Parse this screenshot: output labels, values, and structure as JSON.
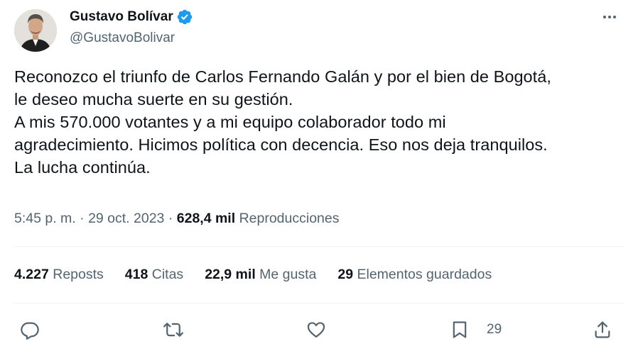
{
  "author": {
    "display_name": "Gustavo Bolívar",
    "handle": "@GustavoBolivar",
    "verified": true,
    "avatar_icon": "avatar-portrait"
  },
  "tweet": {
    "lines": [
      "Reconozco el triunfo de Carlos Fernando Galán y por el bien de Bogotá,",
      "le deseo mucha suerte en su gestión.",
      "A mis 570.000 votantes y a mi equipo colaborador todo mi",
      "agradecimiento. Hicimos política con decencia. Eso nos deja tranquilos.",
      "La lucha continúa."
    ]
  },
  "meta": {
    "time": "5:45 p. m.",
    "separator": "·",
    "date": "29 oct. 2023",
    "views_count": "628,4 mil",
    "views_label": "Reproducciones"
  },
  "stats": [
    {
      "count": "4.227",
      "label": "Reposts"
    },
    {
      "count": "418",
      "label": "Citas"
    },
    {
      "count": "22,9 mil",
      "label": "Me gusta"
    },
    {
      "count": "29",
      "label": "Elementos guardados"
    }
  ],
  "actions": {
    "reply_icon": "reply-icon",
    "repost_icon": "repost-icon",
    "like_icon": "heart-icon",
    "bookmark_icon": "bookmark-icon",
    "bookmark_count": "29",
    "share_icon": "share-icon"
  },
  "colors": {
    "text": "#0f1419",
    "secondary": "#536471",
    "verified": "#1d9bf0",
    "divider": "#eff3f4"
  }
}
